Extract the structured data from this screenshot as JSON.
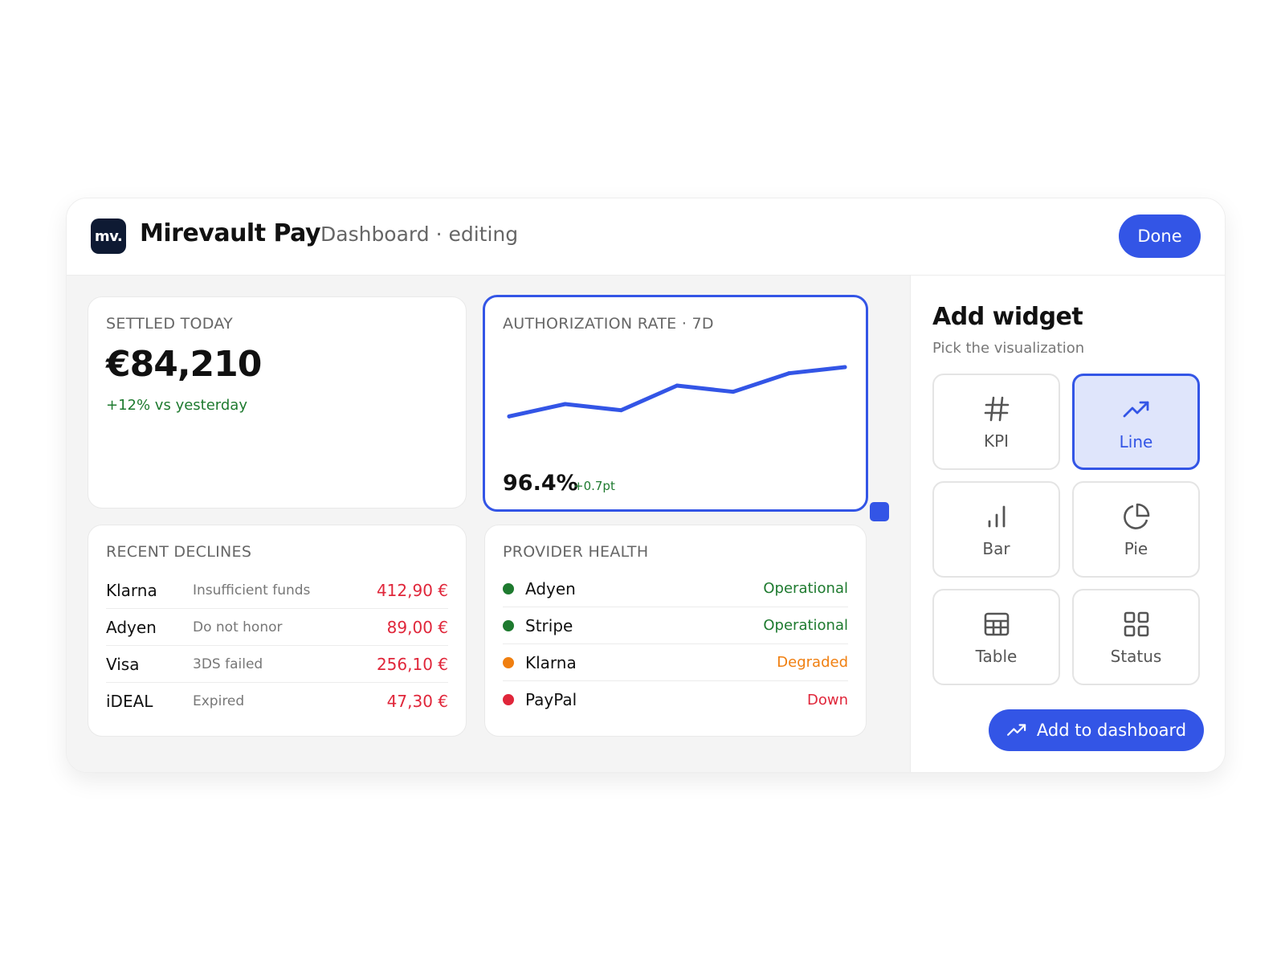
{
  "header": {
    "logo_text": "mv.",
    "brand": "Mirevault Pay",
    "crumb": "Dashboard · editing",
    "done_label": "Done"
  },
  "kpi": {
    "title": "SETTLED TODAY",
    "value": "€84,210",
    "delta": "+12% vs yesterday"
  },
  "auth": {
    "title": "AUTHORIZATION RATE · 7D",
    "value": "96.4%",
    "delta": "+0.7pt"
  },
  "chart_data": {
    "type": "line",
    "title": "AUTHORIZATION RATE · 7D",
    "x": [
      1,
      2,
      3,
      4,
      5,
      6,
      7
    ],
    "series": [
      {
        "values": [
          95.6,
          95.8,
          95.7,
          96.1,
          96.0,
          96.3,
          96.4
        ]
      }
    ],
    "ylim": [
      94.6,
      96.7
    ],
    "grid": false,
    "color": "#3355e6"
  },
  "declines": {
    "title": "RECENT DECLINES",
    "rows": [
      {
        "provider": "Klarna",
        "reason": "Insufficient funds",
        "amount": "412,90 €"
      },
      {
        "provider": "Adyen",
        "reason": "Do not honor",
        "amount": "89,00 €"
      },
      {
        "provider": "Visa",
        "reason": "3DS failed",
        "amount": "256,10 €"
      },
      {
        "provider": "iDEAL",
        "reason": "Expired",
        "amount": "47,30 €"
      }
    ]
  },
  "health": {
    "title": "PROVIDER HEALTH",
    "rows": [
      {
        "name": "Adyen",
        "status": "Operational",
        "color": "#1e7a2f"
      },
      {
        "name": "Stripe",
        "status": "Operational",
        "color": "#1e7a2f"
      },
      {
        "name": "Klarna",
        "status": "Degraded",
        "color": "#f07f10"
      },
      {
        "name": "PayPal",
        "status": "Down",
        "color": "#e0263a"
      }
    ]
  },
  "side": {
    "title": "Add widget",
    "subtitle": "Pick the visualization",
    "tiles": [
      {
        "label": "KPI",
        "icon": "hash-icon"
      },
      {
        "label": "Line",
        "icon": "trend-up-icon",
        "active": true
      },
      {
        "label": "Bar",
        "icon": "bar-chart-icon"
      },
      {
        "label": "Pie",
        "icon": "pie-chart-icon"
      },
      {
        "label": "Table",
        "icon": "table-icon"
      },
      {
        "label": "Status",
        "icon": "grid-icon"
      }
    ],
    "add_label": "Add to dashboard"
  },
  "colors": {
    "accent": "#3355e6",
    "positive": "#1e7a2f",
    "negative": "#e0263a",
    "warning": "#f07f10"
  }
}
